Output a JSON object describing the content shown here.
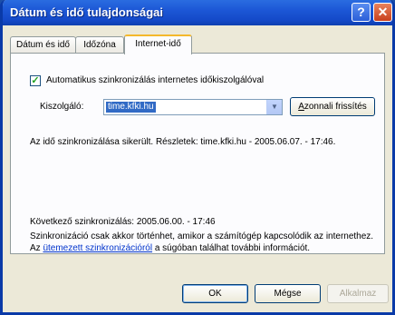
{
  "window": {
    "title": "Dátum és idő tulajdonságai",
    "help_label": "?",
    "close_label": "✕"
  },
  "tabs": [
    {
      "label": "Dátum és idő"
    },
    {
      "label": "Időzóna"
    },
    {
      "label": "Internet-idő",
      "active": true
    }
  ],
  "internet_time": {
    "auto_sync_checked": true,
    "auto_sync_label": "Automatikus szinkronizálás internetes időkiszolgálóval",
    "server_label": "Kiszolgáló:",
    "server_value": "time.kfki.hu",
    "update_button_first": "A",
    "update_button_rest": "zonnali frissítés",
    "status_text": "Az idő szinkronizálása sikerült. Részletek: time.kfki.hu - 2005.06.07. - 17:46.",
    "next_sync": "Következő szinkronizálás: 2005.06.00. - 17:46",
    "info_before": "Szinkronizáció csak akkor történhet, amikor a számítógép kapcsolódik az internethez. Az ",
    "info_link": "ütemezett szinkronizációról",
    "info_after": " a súgóban találhat további információt."
  },
  "buttons": {
    "ok": "OK",
    "cancel": "Mégse",
    "apply": "Alkalmaz"
  }
}
